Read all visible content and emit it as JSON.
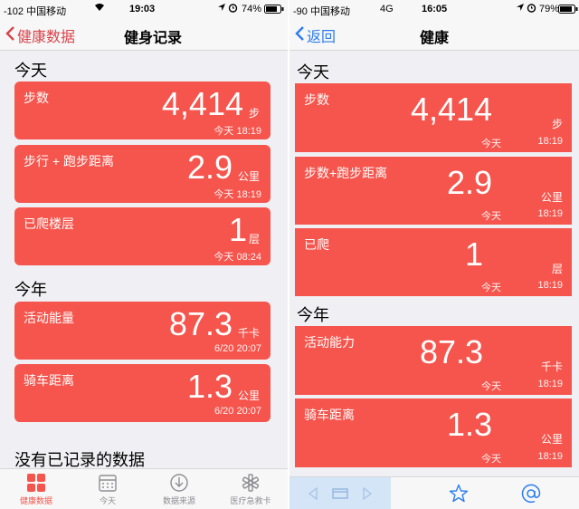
{
  "left": {
    "status": {
      "signal": "-102 中国移动",
      "time": "19:03",
      "battery": "74%"
    },
    "nav": {
      "back_label": "健康数据",
      "title": "健身记录"
    },
    "sections": {
      "today": "今天",
      "year": "今年",
      "empty": "没有已记录的数据"
    },
    "cards": [
      {
        "label": "步数",
        "value": "4,414",
        "unit": "步",
        "time": "今天 18:19"
      },
      {
        "label": "步行 + 跑步距离",
        "value": "2.9",
        "unit": "公里",
        "time": "今天 18:19"
      },
      {
        "label": "已爬楼层",
        "value": "1",
        "unit": "层",
        "time": "今天 08:24"
      },
      {
        "label": "活动能量",
        "value": "87.3",
        "unit": "千卡",
        "time": "6/20 20:07"
      },
      {
        "label": "骑车距离",
        "value": "1.3",
        "unit": "公里",
        "time": "6/20 20:07"
      }
    ],
    "tabs": [
      {
        "label": "健康数据",
        "icon": "dashboard-icon",
        "active": true
      },
      {
        "label": "今天",
        "icon": "calendar-icon",
        "active": false
      },
      {
        "label": "数据来源",
        "icon": "download-icon",
        "active": false
      },
      {
        "label": "医疗急救卡",
        "icon": "medical-id-icon",
        "active": false
      }
    ]
  },
  "right": {
    "status": {
      "signal": "-90 中国移动",
      "network": "4G",
      "time": "16:05",
      "battery": "79%"
    },
    "nav": {
      "back_label": "返回",
      "title": "健康"
    },
    "sections": {
      "today": "今天",
      "year": "今年"
    },
    "cards": [
      {
        "label": "步数",
        "value": "4,414",
        "unit": "步",
        "day": "今天",
        "time": "18:19"
      },
      {
        "label": "步数+跑步距离",
        "value": "2.9",
        "unit": "公里",
        "day": "今天",
        "time": "18:19"
      },
      {
        "label": "已爬",
        "value": "1",
        "unit": "层",
        "day": "今天",
        "time": "18:19"
      },
      {
        "label": "活动能力",
        "value": "87.3",
        "unit": "千卡",
        "day": "今天",
        "time": "18:19"
      },
      {
        "label": "骑车距离",
        "value": "1.3",
        "unit": "公里",
        "day": "今天",
        "time": "18:19"
      }
    ],
    "bottom": {
      "icons": [
        "left-arrow-icon",
        "tab-icon",
        "right-arrow-icon",
        "star-icon",
        "at-icon"
      ]
    }
  },
  "colors": {
    "card": "#f5554d",
    "accent_left": "#d9434a",
    "accent_right": "#2a7cf0"
  }
}
